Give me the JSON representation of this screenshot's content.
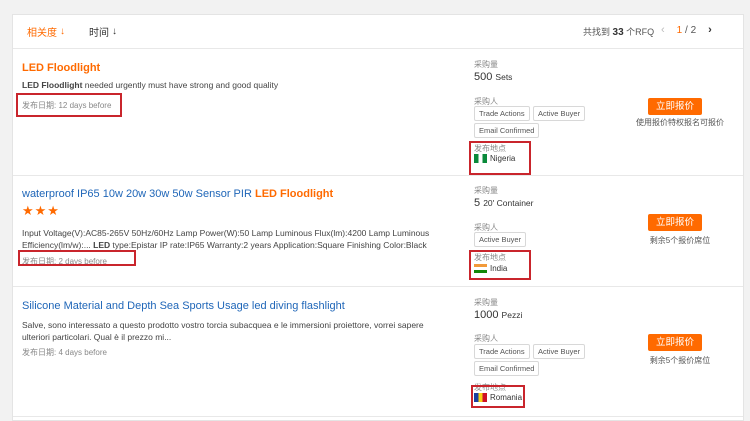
{
  "sort": {
    "relevance_label": "相关度",
    "time_label": "时间"
  },
  "summary": {
    "prefix": "共找到",
    "count": "33",
    "suffix": "个RFQ"
  },
  "pager": {
    "current": "1",
    "total": "2"
  },
  "colors": {
    "accent": "#ff6a00",
    "link": "#1f66b8",
    "highlight_box": "#c9252c"
  },
  "rfqs": [
    {
      "title_plain": "",
      "title_highlight": "LED Floodlight",
      "desc_bold": "LED Floodlight",
      "desc": " needed urgently must have strong and good quality",
      "date_label": "发布日期:",
      "date": "12 days before",
      "qty_label": "采购量",
      "qty_value": "500",
      "qty_unit": "Sets",
      "buyer_label": "采购人",
      "tags": [
        "Trade Actions",
        "Active Buyer",
        "Email Confirmed"
      ],
      "location_label": "发布地点",
      "country": "Nigeria",
      "button": "立即报价",
      "note": "使用报价特权报名可报价"
    },
    {
      "title_plain": "waterproof IP65 10w 20w 30w 50w Sensor PIR ",
      "title_highlight": "LED Floodlight",
      "stars": "★★★",
      "desc": "Input Voltage(V):AC85-265V 50Hz/60Hz Lamp Power(W):50 Lamp Luminous Flux(lm):4200 Lamp Luminous Efficiency(lm/w):...",
      "desc_bold": "LED",
      "desc2": " type:Epistar IP rate:IP65 Warranty:2 years Application:Square Finishing Color:Black",
      "date_label": "发布日期:",
      "date": "2 days before",
      "qty_label": "采购量",
      "qty_value": "5",
      "qty_unit": "20' Container",
      "buyer_label": "采购人",
      "tags": [
        "Active Buyer"
      ],
      "location_label": "发布地点",
      "country": "India",
      "button": "立即报价",
      "note": "剩余5个报价席位"
    },
    {
      "title_plain": "Silicone Material and Depth Sea Sports Usage led diving flashlight",
      "desc": "Salve, sono interessato a questo prodotto vostro torcia subacquea e le immersioni proiettore, vorrei sapere ulteriori particolari. Qual è il prezzo mi...",
      "date_label": "发布日期:",
      "date": "4 days before",
      "qty_label": "采购量",
      "qty_value": "1000",
      "qty_unit": "Pezzi",
      "buyer_label": "采购人",
      "tags": [
        "Trade Actions",
        "Active Buyer",
        "Email Confirmed"
      ],
      "location_label": "发布地点",
      "country": "Romania",
      "button": "立即报价",
      "note": "剩余5个报价席位"
    }
  ]
}
